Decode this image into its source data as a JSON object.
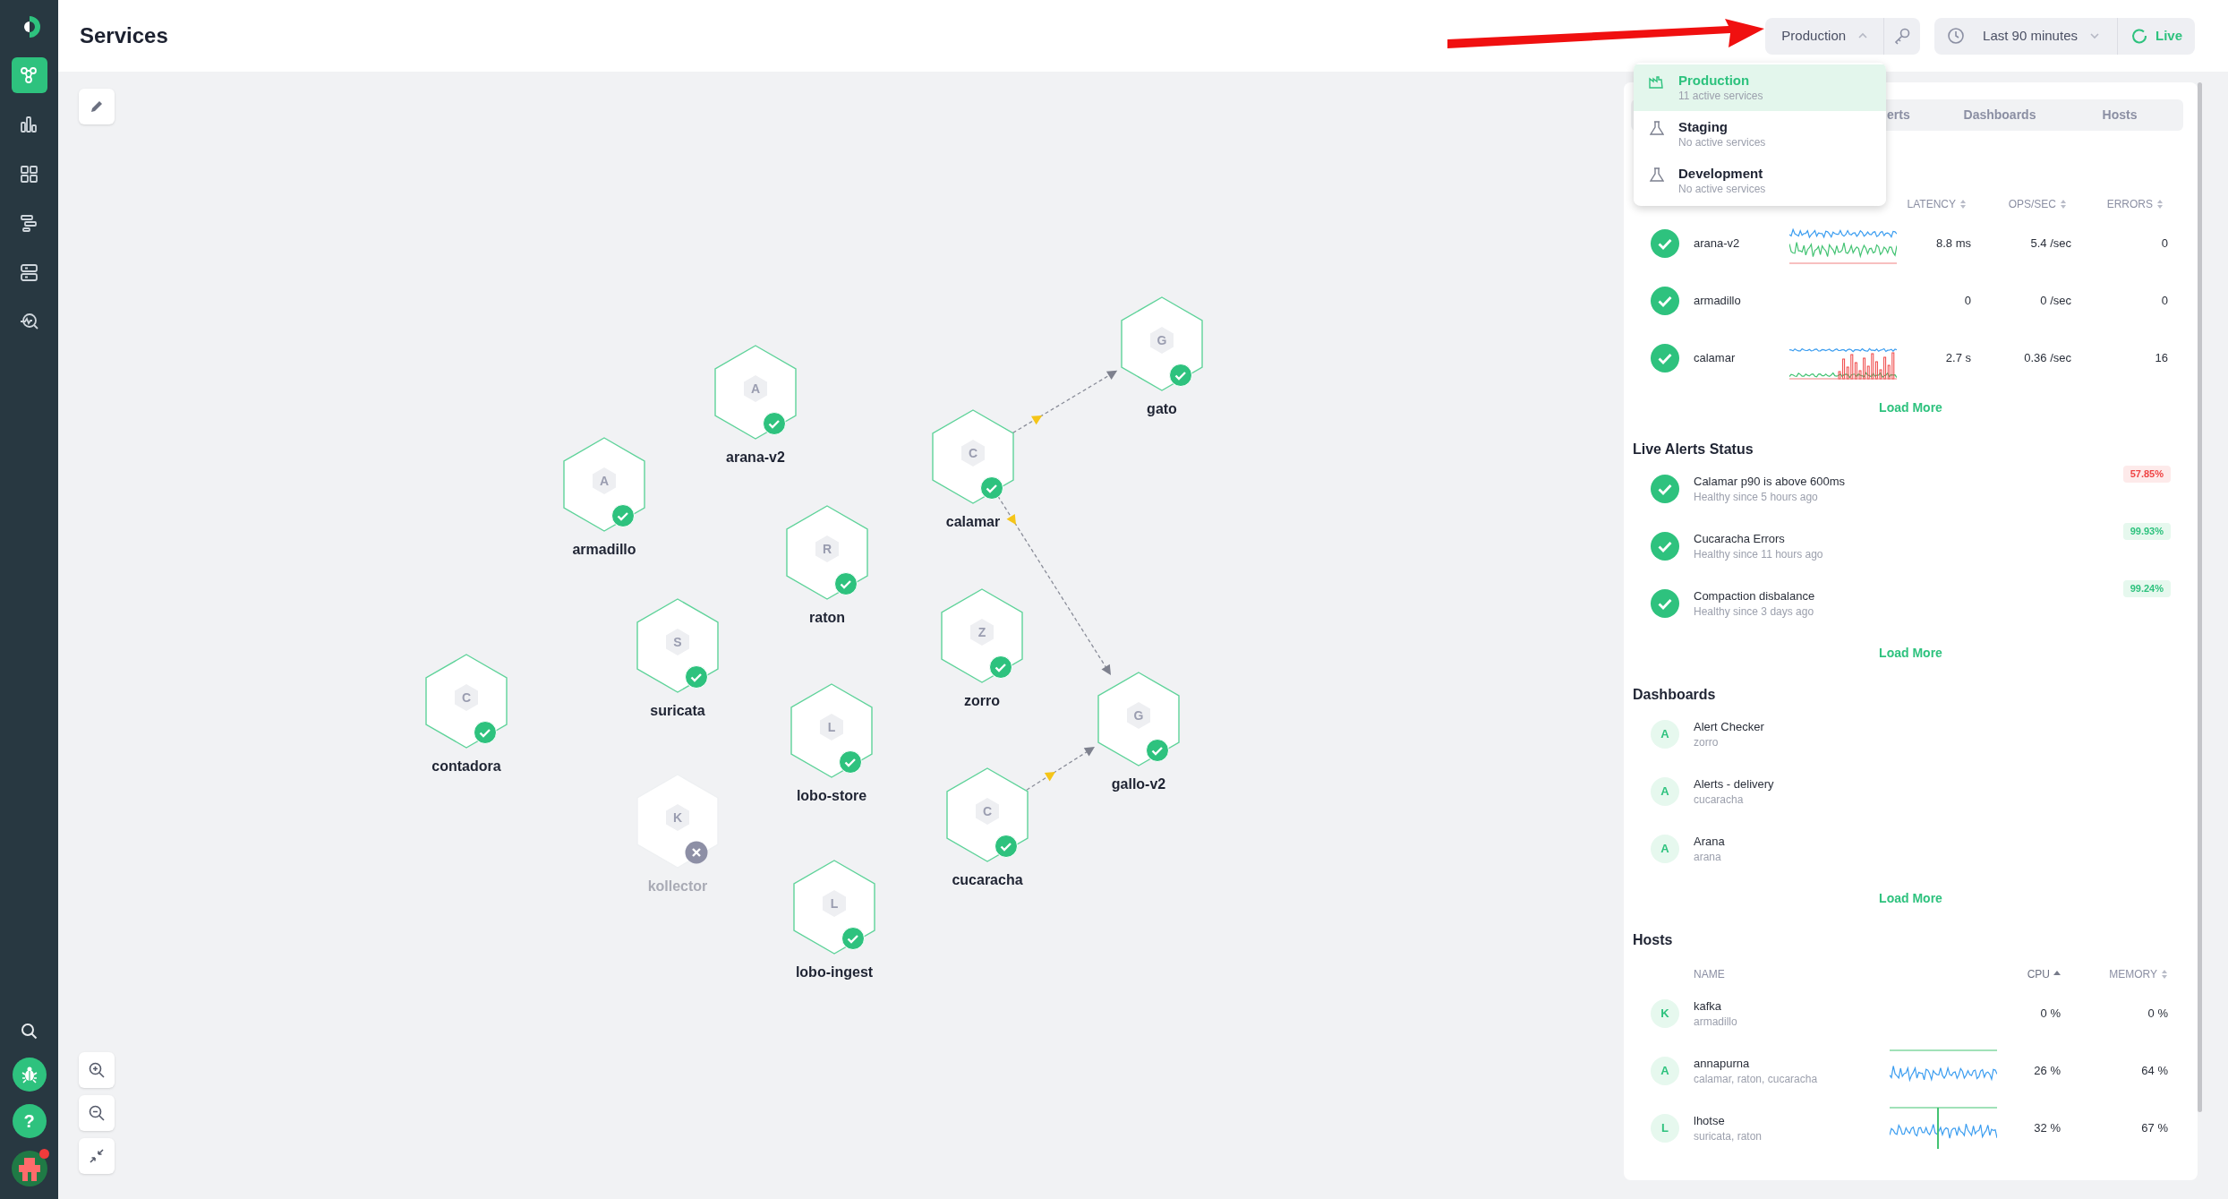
{
  "sidebar": {
    "nav_items": [
      {
        "kind": "services",
        "selected": true
      },
      {
        "kind": "metrics",
        "selected": false
      },
      {
        "kind": "dashboards",
        "selected": false
      },
      {
        "kind": "traces",
        "selected": false
      },
      {
        "kind": "hosts",
        "selected": false
      },
      {
        "kind": "explore",
        "selected": false
      }
    ],
    "help_label": "?",
    "avatar": {
      "notification": true
    }
  },
  "header": {
    "title": "Services",
    "environment": {
      "label": "Production",
      "expanded": true
    },
    "time_range": {
      "label": "Last 90 minutes"
    },
    "live": {
      "label": "Live"
    }
  },
  "environment_menu": [
    {
      "kind": "production",
      "title": "Production",
      "subtitle": "11 active services",
      "selected": true
    },
    {
      "kind": "test",
      "title": "Staging",
      "subtitle": "No active services",
      "selected": false
    },
    {
      "kind": "test",
      "title": "Development",
      "subtitle": "No active services",
      "selected": false
    }
  ],
  "graph": {
    "nodes": [
      {
        "initial": "A",
        "name": "arana-v2",
        "healthy": true
      },
      {
        "initial": "G",
        "name": "gato",
        "healthy": true
      },
      {
        "initial": "A",
        "name": "armadillo",
        "healthy": true
      },
      {
        "initial": "C",
        "name": "calamar",
        "healthy": true
      },
      {
        "initial": "R",
        "name": "raton",
        "healthy": true
      },
      {
        "initial": "S",
        "name": "suricata",
        "healthy": true
      },
      {
        "initial": "Z",
        "name": "zorro",
        "healthy": true
      },
      {
        "initial": "C",
        "name": "contadora",
        "healthy": true
      },
      {
        "initial": "L",
        "name": "lobo-store",
        "healthy": true
      },
      {
        "initial": "G",
        "name": "gallo-v2",
        "healthy": true
      },
      {
        "initial": "K",
        "name": "kollector",
        "healthy": false
      },
      {
        "initial": "C",
        "name": "cucaracha",
        "healthy": true
      },
      {
        "initial": "L",
        "name": "lobo-ingest",
        "healthy": true
      }
    ]
  },
  "panel": {
    "tabs": [
      {
        "label": "erts"
      },
      {
        "label": "Dashboards"
      },
      {
        "label": "Hosts"
      }
    ],
    "services": {
      "columns": [
        {
          "label": "LATENCY",
          "sortable": true,
          "sorted": false
        },
        {
          "label": "OPS/SEC",
          "sortable": true,
          "sorted": false
        },
        {
          "label": "ERRORS",
          "sortable": true,
          "sorted": false
        }
      ],
      "rows": [
        {
          "name": "arana-v2",
          "healthy": true,
          "sparkline": true,
          "latency": "8.8 ms",
          "ops": "5.4 /sec",
          "errors": "0"
        },
        {
          "name": "armadillo",
          "healthy": true,
          "sparkline": false,
          "latency": "0",
          "ops": "0 /sec",
          "errors": "0"
        },
        {
          "name": "calamar",
          "healthy": true,
          "sparkline": true,
          "latency": "2.7 s",
          "ops": "0.36 /sec",
          "errors": "16"
        }
      ],
      "load_more": "Load More"
    },
    "alerts": {
      "title": "Live Alerts Status",
      "items": [
        {
          "title": "Calamar p90 is above 600ms",
          "subtitle": "Healthy since 5 hours ago",
          "healthy": true,
          "value": "57.85%",
          "warning": true
        },
        {
          "title": "Cucaracha Errors",
          "subtitle": "Healthy since 11 hours ago",
          "healthy": true,
          "value": "99.93%",
          "warning": false
        },
        {
          "title": "Compaction disbalance",
          "subtitle": "Healthy since 3 days ago",
          "healthy": true,
          "value": "99.24%",
          "warning": false
        }
      ],
      "load_more": "Load More"
    },
    "dashboards": {
      "title": "Dashboards",
      "items": [
        {
          "initial": "A",
          "title": "Alert Checker",
          "subtitle": "zorro"
        },
        {
          "initial": "A",
          "title": "Alerts - delivery",
          "subtitle": "cucaracha"
        },
        {
          "initial": "A",
          "title": "Arana",
          "subtitle": "arana"
        }
      ],
      "load_more": "Load More"
    },
    "hosts": {
      "title": "Hosts",
      "columns": [
        {
          "label": "NAME"
        },
        {
          "label": "CPU",
          "sortable": true,
          "sorted": true
        },
        {
          "label": "MEMORY",
          "sortable": true,
          "sorted": false
        }
      ],
      "rows": [
        {
          "initial": "K",
          "name": "kafka",
          "services": "armadillo",
          "sparkline": false,
          "cpu": "0 %",
          "memory": "0 %"
        },
        {
          "initial": "A",
          "name": "annapurna",
          "services": "calamar, raton, cucaracha",
          "sparkline": true,
          "cpu": "26 %",
          "memory": "64 %"
        },
        {
          "initial": "L",
          "name": "lhotse",
          "services": "suricata, raton",
          "sparkline": true,
          "cpu": "32 %",
          "memory": "67 %"
        }
      ]
    }
  }
}
